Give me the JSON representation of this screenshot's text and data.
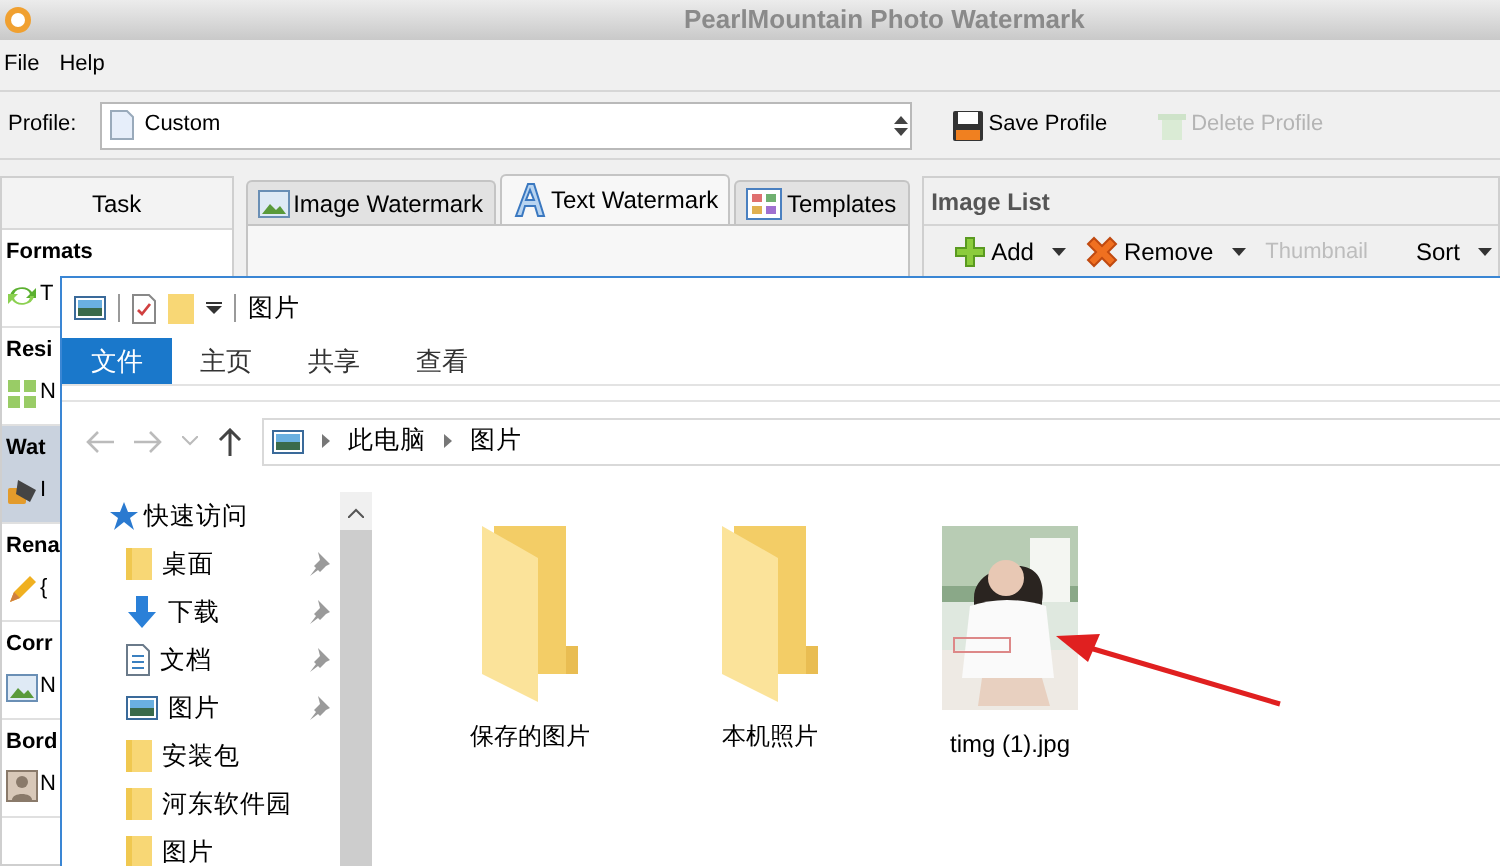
{
  "app": {
    "title": "PearlMountain Photo Watermark",
    "menu": [
      "File",
      "Help"
    ],
    "profile": {
      "label": "Profile:",
      "value": "Custom"
    },
    "profile_buttons": [
      {
        "label": "Save Profile",
        "disabled": false
      },
      {
        "label": "Delete Profile",
        "disabled": true
      }
    ],
    "task_panel": {
      "header": "Task",
      "sections": [
        {
          "title": "Formats",
          "item": "T",
          "selected": false
        },
        {
          "title": "Resi",
          "item": "N",
          "selected": false
        },
        {
          "title": "Wat",
          "item": "I",
          "selected": true
        },
        {
          "title": "Rena",
          "item": "{",
          "selected": false
        },
        {
          "title": "Corr",
          "item": "N",
          "selected": false
        },
        {
          "title": "Bord",
          "item": "N",
          "selected": false
        }
      ]
    },
    "tabs": [
      {
        "label": "Image Watermark",
        "selected": false
      },
      {
        "label": "Text Watermark",
        "selected": true
      },
      {
        "label": "Templates",
        "selected": false
      }
    ],
    "image_list": {
      "title": "Image List",
      "tools": [
        {
          "label": "Add",
          "dropdown": true,
          "disabled": false
        },
        {
          "label": "Remove",
          "dropdown": true,
          "disabled": false
        },
        {
          "label": "Thumbnail",
          "dropdown": false,
          "disabled": true
        },
        {
          "label": "Sort",
          "dropdown": true,
          "disabled": false
        }
      ]
    }
  },
  "explorer": {
    "title": "图片",
    "ribbon_tabs": [
      {
        "label": "文件",
        "selected": true
      },
      {
        "label": "主页",
        "selected": false
      },
      {
        "label": "共享",
        "selected": false
      },
      {
        "label": "查看",
        "selected": false
      }
    ],
    "breadcrumb": [
      "此电脑",
      "图片"
    ],
    "nav": {
      "header": "快速访问",
      "items": [
        {
          "label": "桌面",
          "pinned": true
        },
        {
          "label": "下载",
          "pinned": true
        },
        {
          "label": "文档",
          "pinned": true
        },
        {
          "label": "图片",
          "pinned": true
        },
        {
          "label": "安装包",
          "pinned": false
        },
        {
          "label": "河东软件园",
          "pinned": false
        },
        {
          "label": "图片",
          "pinned": false
        }
      ]
    },
    "files": [
      {
        "name": "保存的图片",
        "kind": "folder"
      },
      {
        "name": "本机照片",
        "kind": "folder"
      },
      {
        "name": "timg (1).jpg",
        "kind": "picture"
      }
    ]
  }
}
